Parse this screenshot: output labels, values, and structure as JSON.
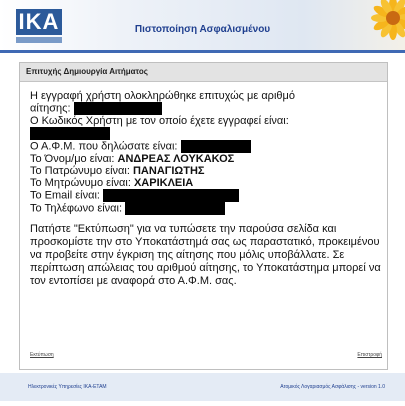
{
  "header": {
    "logo_text": "IKA",
    "title": "Πιστοποίηση Ασφαλισμένου"
  },
  "panel": {
    "heading": "Επιτυχής Δημιουργία Αιτήματος",
    "line1": "Η εγγραφή χρήστη ολοκληρώθηκε επιτυχώς με αριθμό",
    "line2_label": "αίτησης:",
    "line3": "Ο Κωδικός Χρήστη με τον οποίο έχετε εγγραφεί είναι:",
    "afm_label": "Ο Α.Φ.Μ. που δηλώσατε είναι:",
    "name_label": "Το Όνομ/μο είναι:",
    "name_value": "ΑΝΔΡΕΑΣ ΛΟΥΚΑΚΟΣ",
    "father_label": "Το Πατρώνυμο είναι:",
    "father_value": "ΠΑΝΑΓΙΩΤΗΣ",
    "mother_label": "Το Μητρώνυμο είναι:",
    "mother_value": "ΧΑΡΙΚΛΕΙΑ",
    "email_label": "Το Email είναι:",
    "phone_label": "Το Τηλέφωνο είναι:",
    "instructions": "Πατήστε \"Εκτύπωση\" για να τυπώσετε την παρούσα σελίδα και προσκομίστε την στο Υποκατάστημά σας ως παραστατικό, προκειμένου να προβείτε στην έγκριση της αίτησης που μόλις υποβάλλατε. Σε περίπτωση απώλειας του αριθμού αίτησης, το Υποκατάστημα μπορεί να τον εντοπίσει με αναφορά στο Α.Φ.Μ. σας.",
    "print_link": "Εκτύπωση",
    "back_link": "Επιστροφή"
  },
  "footer": {
    "left": "Ηλεκτρονικές Υπηρεσίες ΙΚΑ-ΕΤΑΜ",
    "right": "Ατομικός Λογαριασμός Ασφάλισης - version 1.0"
  },
  "colors": {
    "brand": "#2c5a9a",
    "title": "#1f3f8f",
    "rule": "#3f69b4"
  }
}
